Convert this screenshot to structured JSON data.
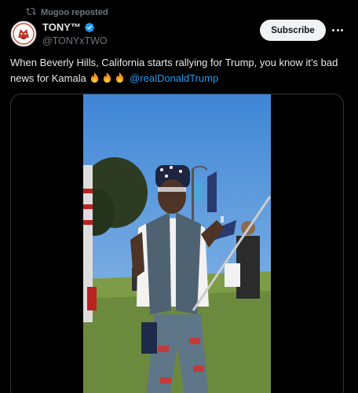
{
  "repost": {
    "text": "Mugoo reposted",
    "icon": "repost-icon"
  },
  "author": {
    "display_name": "TONY™",
    "handle": "@TONYxTWO",
    "verified": true,
    "verified_color": "#1d9bf0"
  },
  "actions": {
    "subscribe_label": "Subscribe",
    "more_icon": "more-icon"
  },
  "tweet": {
    "text": "When Beverly Hills, California starts rallying for Trump, you know it’s bad news for Kamala",
    "emojis": [
      "fire",
      "fire",
      "fire"
    ],
    "mention": "@realDonaldTrump"
  },
  "colors": {
    "background": "#000000",
    "text": "#e7e9ea",
    "muted": "#71767b",
    "link": "#1d9bf0",
    "button_bg": "#eff3f4"
  }
}
